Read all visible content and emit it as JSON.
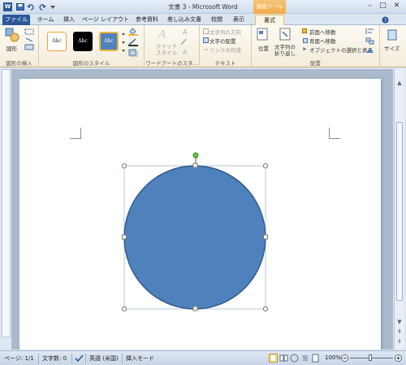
{
  "window": {
    "title": "文書 3 - Microsoft Word",
    "app_letter": "W",
    "controls": {
      "minimize": "–",
      "maximize": "□",
      "close": "✕"
    }
  },
  "quick_access": [
    "save-icon",
    "undo-icon",
    "redo-icon",
    "customize-icon"
  ],
  "context_tab_label": "描画ツール",
  "tabs": [
    {
      "label": "ファイル"
    },
    {
      "label": "ホーム"
    },
    {
      "label": "挿入"
    },
    {
      "label": "ページ レイアウト"
    },
    {
      "label": "参考資料"
    },
    {
      "label": "差し込み文書"
    },
    {
      "label": "校閲"
    },
    {
      "label": "表示"
    },
    {
      "label": "書式"
    }
  ],
  "ribbon": {
    "insert_shapes": {
      "shape_label": "図形",
      "group_label": "図形の挿入"
    },
    "shape_styles": {
      "swatches": [
        {
          "label": "Abc",
          "fill": "#ffffff",
          "border": "#f0a030",
          "text_color": "#333333"
        },
        {
          "label": "Abc",
          "fill": "#000000",
          "border": "#000000",
          "text_color": "#ffffff"
        },
        {
          "label": "Abc",
          "fill": "#4f81bd",
          "border": "#f2b536",
          "text_color": "#ffffff"
        }
      ],
      "group_label": "図形のスタイル"
    },
    "wordart": {
      "quick_style_label1": "クイック",
      "quick_style_label2": "スタイル",
      "group_label": "ワードアートのスタ..."
    },
    "text": {
      "direction": "文字列の方向",
      "align": "文字の配置",
      "link": "リンクの作成",
      "group_label": "テキスト"
    },
    "arrange": {
      "position": "位置",
      "wrap1": "文字列の",
      "wrap2": "折り返し",
      "bring_forward": "前面へ移動",
      "send_backward": "背面へ移動",
      "selection_pane": "オブジェクトの選択と表示",
      "group_label": "配置"
    },
    "size": {
      "label": "サイズ"
    }
  },
  "shape": {
    "fill": "#4f81bd",
    "stroke": "#2e5a8a",
    "rotate_handle_color": "#6cc24a"
  },
  "status": {
    "page": "ページ: 1/1",
    "words": "文字数: 0",
    "language": "英語 (米国)",
    "mode": "挿入モード",
    "zoom": "100%"
  }
}
